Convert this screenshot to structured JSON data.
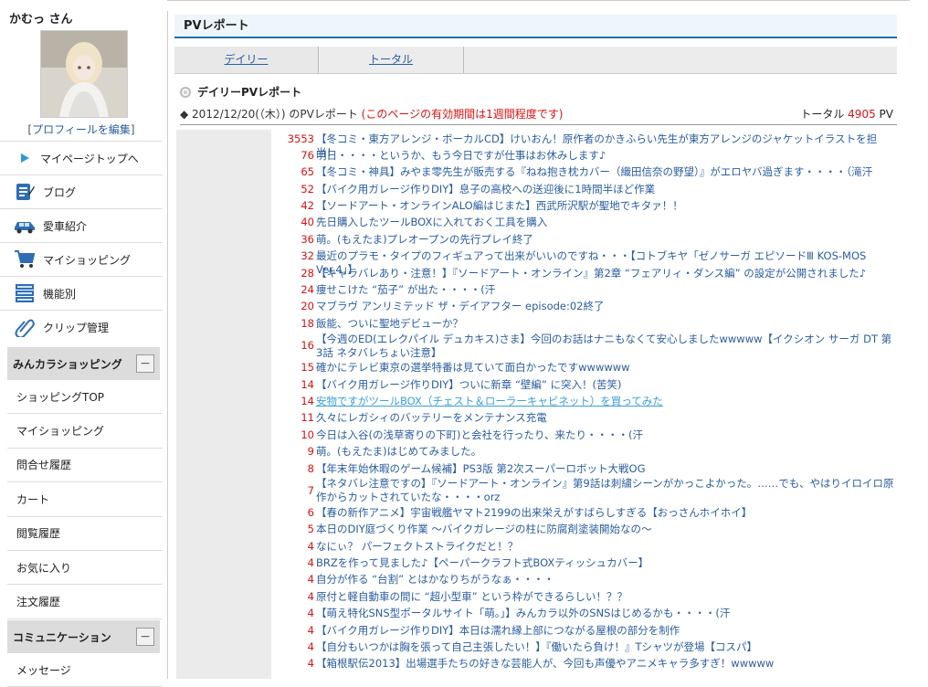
{
  "user": {
    "name": "かむっ さん",
    "edit_profile": "プロフィールを編集",
    "bracket_open": "[",
    "bracket_close": "]"
  },
  "nav": [
    {
      "label": "マイページトップへ",
      "icon": "play-arrow-icon"
    },
    {
      "label": "ブログ",
      "icon": "blog-icon"
    },
    {
      "label": "愛車紹介",
      "icon": "car-icon"
    },
    {
      "label": "マイショッピング",
      "icon": "cart-icon"
    },
    {
      "label": "機能別",
      "icon": "list-icon"
    },
    {
      "label": "クリップ管理",
      "icon": "clip-icon"
    }
  ],
  "section_shopping": {
    "title": "みんカラショッピング",
    "toggle": "−",
    "items": [
      "ショッピングTOP",
      "マイショッピング",
      "問合せ履歴",
      "カート",
      "閲覧履歴",
      "お気に入り",
      "注文履歴"
    ]
  },
  "section_community": {
    "title": "コミュニケーション",
    "toggle": "−",
    "items": [
      "メッセージ"
    ]
  },
  "main": {
    "header": "PVレポート",
    "tabs": [
      "デイリー",
      "トータル"
    ],
    "daily_title": "デイリーPVレポート",
    "report_prefix": "◆ 2012/12/20(（木）) のPVレポート",
    "report_note": "(このページの有効期間は1週間程度です)",
    "total_label": "トータル",
    "total_value": "4905",
    "total_unit": "PV"
  },
  "rows": [
    {
      "count": "3553",
      "title": "【冬コミ・東方アレンジ・ボーカルCD】けいおん！原作者のかきふらい先生が東方アレンジのジャケットイラストを担当！"
    },
    {
      "count": "76",
      "title": "明日・・・・というか、もう今日ですが仕事はお休みします♪"
    },
    {
      "count": "65",
      "title": "【冬コミ・神具】みやま零先生が販売する『ねね抱き枕カバー（織田信奈の野望）』がエロヤバ過ぎます・・・・（滝汗"
    },
    {
      "count": "52",
      "title": "【バイク用ガレージ作りDIY】息子の高校への送迎後に1時間半ほど作業"
    },
    {
      "count": "42",
      "title": "【ソードアート・オンラインALO編はじまた】西武所沢駅が聖地でキタァ！！"
    },
    {
      "count": "40",
      "title": "先日購入したツールBOXに入れておく工具を購入"
    },
    {
      "count": "36",
      "title": "萌。(もえたま)プレオープンの先行プレイ終了"
    },
    {
      "count": "32",
      "title": "最近のプラモ・タイプのフィギュアって出来がいいのですね・・・【コトブキヤ「ゼノサーガ エピソードⅢ KOS-MOS Ver.4」】"
    },
    {
      "count": "28",
      "title": "【キャラバレあり・注意！】『ソードアート・オンライン』第2章 “フェアリィ・ダンス編” の設定が公開されました♪"
    },
    {
      "count": "24",
      "title": "痩せこけた “茄子” が出た・・・・(汗"
    },
    {
      "count": "20",
      "title": "マブラヴ アンリミテッド ザ・デイアフター episode:02終了"
    },
    {
      "count": "18",
      "title": "飯能、ついに聖地デビューか？"
    },
    {
      "count": "16",
      "title": "【今週のED(エレクパイル デュカキス)さま】今回のお話はナニもなくて安心しましたwwwww【イクシオン サーガ DT 第3話 ネタバレちょい注意】",
      "two_line": true
    },
    {
      "count": "15",
      "title": "確かにテレビ東京の選挙特番は見ていて面白かったですwwwwww"
    },
    {
      "count": "14",
      "title": "【バイク用ガレージ作りDIY】ついに新章 “壁編” に突入！(苦笑)"
    },
    {
      "count": "14",
      "title": "安物ですがツールBOX（チェスト＆ローラーキャビネット）を買ってみた",
      "visited": true
    },
    {
      "count": "11",
      "title": "久々にレガシィのバッテリーをメンテナンス充電"
    },
    {
      "count": "10",
      "title": "今日は入谷(の浅草寄りの下町)と会社を行ったり、来たり・・・・(汗"
    },
    {
      "count": "9",
      "title": "萌。(もえたま)はじめてみました。"
    },
    {
      "count": "8",
      "title": "【年末年始休暇のゲーム候補】PS3版 第2次スーパーロボット大戦OG"
    },
    {
      "count": "7",
      "title": "【ネタバレ注意ですの】『ソードアート・オンライン』第9話は刺繍シーンがかっこよかった。……でも、やはりイロイロ原作からカットされていたな・・・・orz",
      "two_line": true
    },
    {
      "count": "6",
      "title": "【春の新作アニメ】宇宙戦艦ヤマト2199の出来栄えがすばらしすぎる【おっさんホイホイ】"
    },
    {
      "count": "5",
      "title": "本日のDIY庭づくり作業 ～バイクガレージの柱に防腐剤塗装開始なの～"
    },
    {
      "count": "4",
      "title": "なにぃ？ パーフェクトストライクだと！？"
    },
    {
      "count": "4",
      "title": "BRZを作って見ました♪【ペーパークラフト式BOXティッシュカバー】"
    },
    {
      "count": "4",
      "title": "自分が作る “台割” とはかなりちがうなぁ・・・・"
    },
    {
      "count": "4",
      "title": "原付と軽自動車の間に “超小型車” という枠ができるらしい！？？"
    },
    {
      "count": "4",
      "title": "【萌え特化SNS型ポータルサイト「萌。」】みんカラ以外のSNSはじめるかも・・・・(汗"
    },
    {
      "count": "4",
      "title": "【バイク用ガレージ作りDIY】本日は濡れ縁上部につながる屋根の部分を制作"
    },
    {
      "count": "4",
      "title": "【自分もいつかは胸を張って自己主張したい！】『働いたら負け！』Tシャツが登場【コスパ】"
    },
    {
      "count": "4",
      "title": "【箱根駅伝2013】出場選手たちの好きな芸能人が、今回も声優やアニメキャラ多すぎ！wwwww"
    }
  ],
  "colors": {
    "accent": "#1e6fa8",
    "count_red": "#d11",
    "link": "#2b5d9e",
    "visited": "#3ba0d8"
  }
}
